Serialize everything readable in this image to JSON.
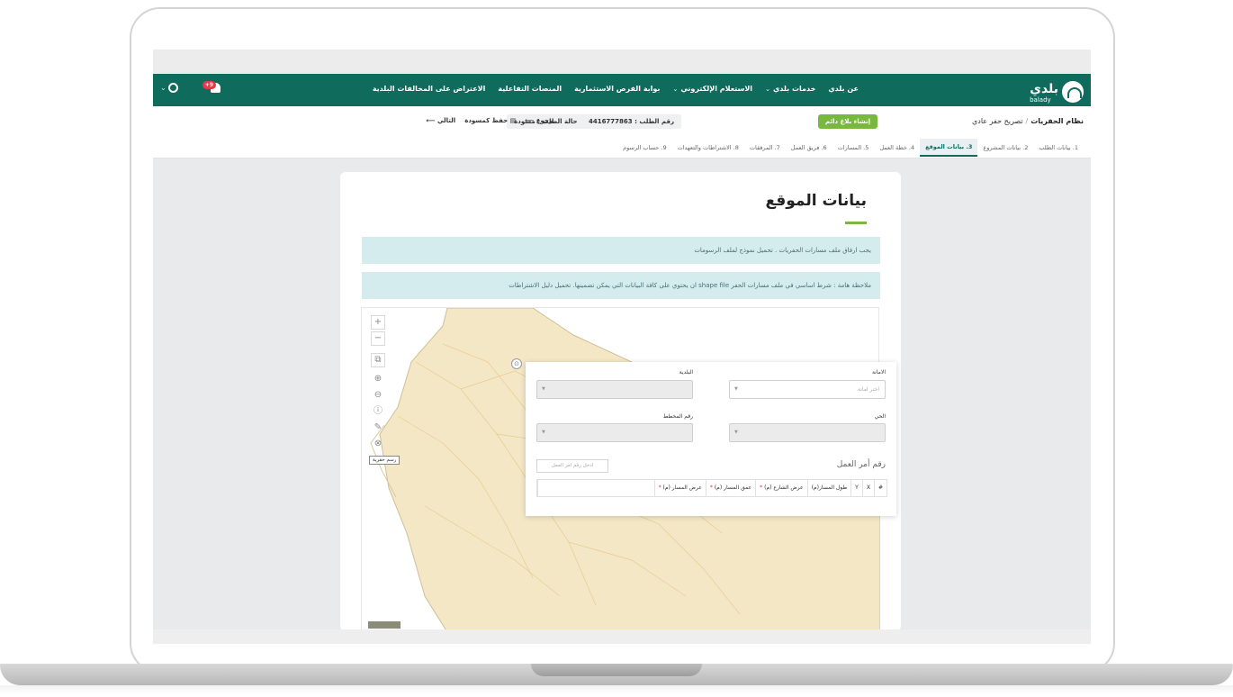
{
  "navbar": {
    "logo_text": "بلدي",
    "logo_sub": "balady",
    "items": [
      {
        "label": "عن بلدي",
        "has_menu": false
      },
      {
        "label": "خدمات بلدي",
        "has_menu": true
      },
      {
        "label": "الاستعلام الإلكتروني",
        "has_menu": true
      },
      {
        "label": "بوابة الفرص الاستثمارية",
        "has_menu": false
      },
      {
        "label": "المنصات التفاعلية",
        "has_menu": false
      },
      {
        "label": "الاعتراض على المخالفات البلدية",
        "has_menu": false
      }
    ],
    "notification_count": "+9",
    "user_menu_chevron": "⌄",
    "menu_chevron": "⌄"
  },
  "breadcrumb": {
    "system": "نظام الحفريات",
    "separator": "/",
    "permit": "تصريح حفر عادي"
  },
  "report_button": "إنشاء بلاغ دائم",
  "request": {
    "number_label": "رقم الطلب : 4416777863",
    "status_label": "حالة الطلب : مسودة"
  },
  "actions": {
    "back": "رجوع",
    "save_draft": "حفظ كمسودة",
    "next": "التالي"
  },
  "steps": [
    {
      "label": "1. بيانات الطلب",
      "active": false
    },
    {
      "label": "2. بيانات المشروع",
      "active": false
    },
    {
      "label": "3. بيانات الموقع",
      "active": true
    },
    {
      "label": "4. خطة العمل",
      "active": false
    },
    {
      "label": "5. المسارات",
      "active": false
    },
    {
      "label": "6. فريق العمل",
      "active": false
    },
    {
      "label": "7. المرفقات",
      "active": false
    },
    {
      "label": "8. الاشتراطات والتعهدات",
      "active": false
    },
    {
      "label": "9. حساب الرسوم",
      "active": false
    }
  ],
  "page_title": "بيانات الموقع",
  "alerts": {
    "attach_note": "يجب ارفاق ملف مسارات الحفريات . تحميل نموذج لملف الرسومات",
    "shape_note": "ملاحظة هامة : شرط اساسي في ملف مسارات الحفر shape file ان يحتوي على كافة البيانات التي يمكن تضمينها. تحميل دليل الاشتراطات"
  },
  "map": {
    "tools": [
      "+",
      "−",
      "layers-icon",
      "zoom-in-icon",
      "zoom-out-icon",
      "info-icon",
      "attach-icon",
      "draw-icon"
    ],
    "draw_tooltip": "رسم حفرية"
  },
  "form": {
    "amana_label": "الامانة",
    "amana_placeholder": "اختر امانة",
    "baladiya_label": "البلدية",
    "district_label": "الحي",
    "plan_label": "رقم المخطط",
    "work_order_label": "رقم أمر العمل",
    "work_order_placeholder": "ادخل رقم امر العمل",
    "columns": [
      {
        "label": "#",
        "required": false
      },
      {
        "label": "X",
        "required": false
      },
      {
        "label": "Y",
        "required": false
      },
      {
        "label": "طول المسار(م)",
        "required": false
      },
      {
        "label": "عرض الشارع (م)",
        "required": true
      },
      {
        "label": "عمق المسار (م)",
        "required": true
      },
      {
        "label": "عرض المسار (م)",
        "required": true
      }
    ]
  },
  "colors": {
    "nav_green": "#0f6b5c",
    "accent_green": "#78b83e",
    "alert_bg": "#d5ecef"
  }
}
